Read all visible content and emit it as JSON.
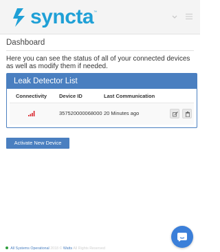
{
  "header": {
    "logo_text": "syncta",
    "logo_tm": "™",
    "brand_color": "#1fa0d6"
  },
  "page": {
    "title": "Dashboard",
    "intro": "Here you can see the status of all of your connected devices as well as modify them if needed."
  },
  "panel": {
    "title": "Leak Detector List",
    "columns": [
      "Connectivity",
      "Device ID",
      "Last Communication"
    ],
    "rows": [
      {
        "connectivity_icon": "signal-bars-icon",
        "device_id": "357520000068000",
        "last_communication": "20 Minutes ago",
        "actions": [
          "edit-icon",
          "trash-icon"
        ]
      }
    ],
    "accent": "#4a7fc0"
  },
  "actions": {
    "activate_label": "Activate New Device"
  },
  "footer": {
    "status": "All Systems Operational",
    "copyright": "2018 ©",
    "brand": "Watts",
    "rights": "All Rights Reserved"
  },
  "chat": {
    "icon": "chat-bubble-icon",
    "color": "#3b7fd9"
  }
}
